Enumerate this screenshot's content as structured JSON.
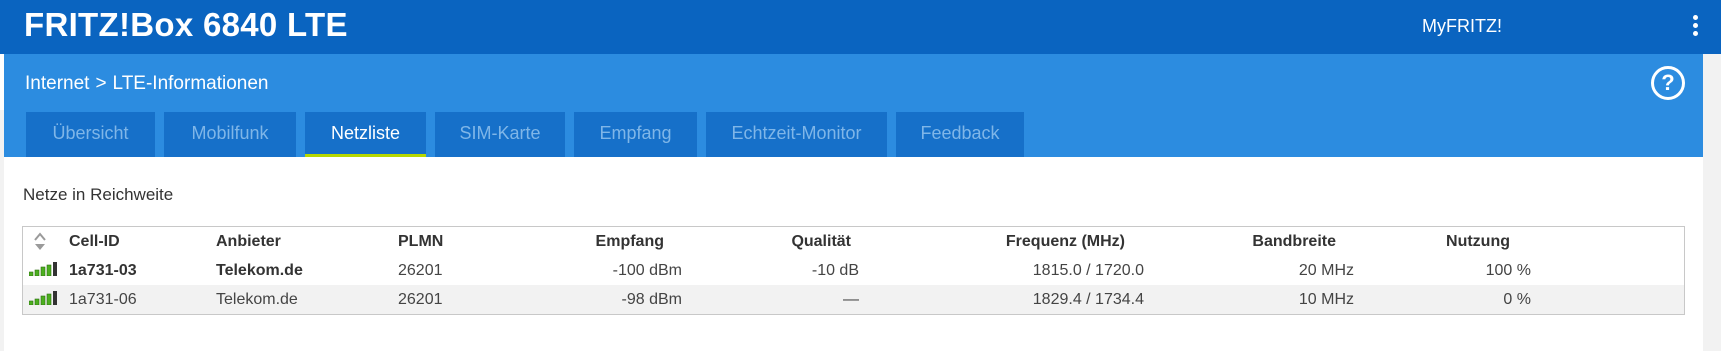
{
  "app": {
    "title": "FRITZ!Box 6840 LTE",
    "myfritz_label": "MyFRITZ!"
  },
  "breadcrumb": {
    "parent": "Internet",
    "separator": ">",
    "current": "LTE-Informationen"
  },
  "tabs": [
    {
      "label": "Übersicht",
      "active": false
    },
    {
      "label": "Mobilfunk",
      "active": false
    },
    {
      "label": "Netzliste",
      "active": true
    },
    {
      "label": "SIM-Karte",
      "active": false
    },
    {
      "label": "Empfang",
      "active": false
    },
    {
      "label": "Echtzeit-Monitor",
      "active": false
    },
    {
      "label": "Feedback",
      "active": false
    }
  ],
  "section": {
    "title": "Netze in Reichweite"
  },
  "table": {
    "columns": [
      "Cell-ID",
      "Anbieter",
      "PLMN",
      "Empfang",
      "Qualität",
      "Frequenz (MHz)",
      "Bandbreite",
      "Nutzung"
    ],
    "rows": [
      {
        "cell_id": "1a731-03",
        "anbieter": "Telekom.de",
        "plmn": "26201",
        "empfang": "-100 dBm",
        "qualitaet": "-10 dB",
        "frequenz": "1815.0 / 1720.0",
        "bandbreite": "20 MHz",
        "nutzung": "100 %",
        "bold": true,
        "signal_icon": "signal-strength-icon"
      },
      {
        "cell_id": "1a731-06",
        "anbieter": "Telekom.de",
        "plmn": "26201",
        "empfang": "-98 dBm",
        "qualitaet": "—",
        "frequenz": "1829.4 / 1734.4",
        "bandbreite": "10 MHz",
        "nutzung": "0 %",
        "bold": false,
        "signal_icon": "signal-strength-icon"
      }
    ]
  },
  "colors": {
    "topbar": "#0a64c0",
    "header_band": "#2c8ce0",
    "tab_bg": "#1670c9",
    "tab_active_underline": "#b6d700",
    "signal_green": "#4caf1f"
  }
}
